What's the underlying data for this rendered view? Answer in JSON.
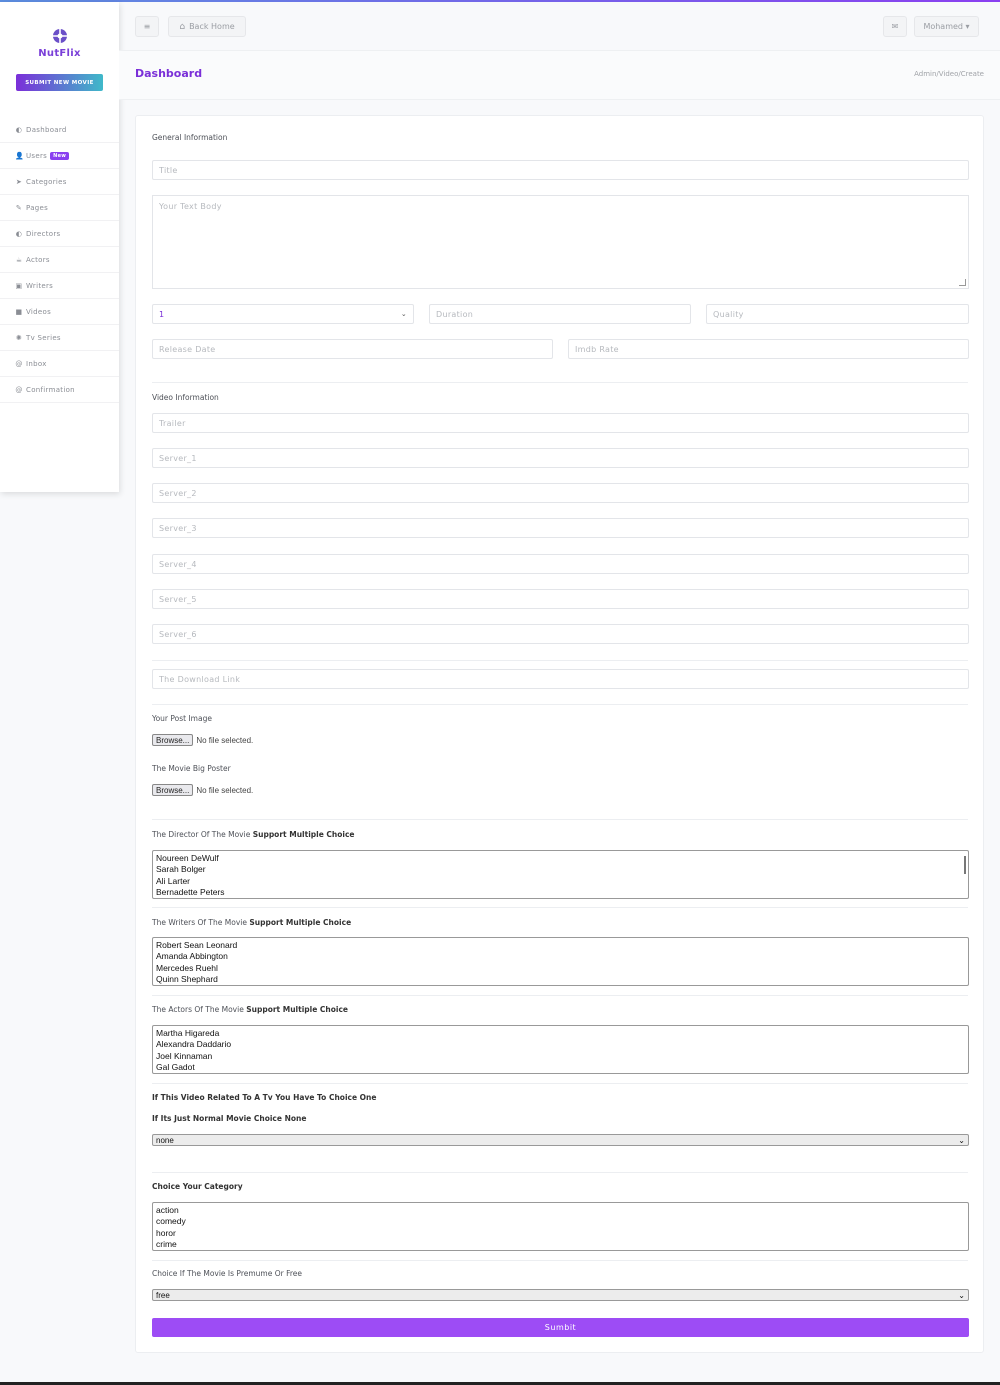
{
  "app": {
    "brand": "NutFlix",
    "submit_new_movie": "SUBMIT NEW MOVIE"
  },
  "sidebar": {
    "items": [
      {
        "icon": "◐",
        "label": "Dashboard"
      },
      {
        "icon": "👤",
        "label": "Users",
        "badge": "New"
      },
      {
        "icon": "➤",
        "label": "Categories"
      },
      {
        "icon": "✎",
        "label": "Pages"
      },
      {
        "icon": "◐",
        "label": "Directors"
      },
      {
        "icon": "☕",
        "label": "Actors"
      },
      {
        "icon": "▣",
        "label": "Writers"
      },
      {
        "icon": "■",
        "label": "Videos"
      },
      {
        "icon": "✺",
        "label": "Tv Series"
      },
      {
        "icon": "@",
        "label": "Inbox"
      },
      {
        "icon": "@",
        "label": "Confirmation"
      }
    ]
  },
  "topbar": {
    "menu_icon": "≡",
    "back_home": "Back Home",
    "home_icon": "⌂",
    "mail_icon": "✉",
    "user": "Mohamed ▾"
  },
  "header": {
    "title": "Dashboard",
    "breadcrumb": "Admin/Video/Create"
  },
  "form": {
    "general_heading": "General Information",
    "title_placeholder": "Title",
    "body_placeholder": "Your Text Body",
    "select_value": "1",
    "duration_placeholder": "Duration",
    "quality_placeholder": "Quality",
    "release_placeholder": "Release Date",
    "imdb_placeholder": "Imdb Rate",
    "video_heading": "Video Information",
    "trailer_placeholder": "Trailer",
    "servers": [
      "Server_1",
      "Server_2",
      "Server_3",
      "Server_4",
      "Server_5",
      "Server_6"
    ],
    "download_placeholder": "The Download Link",
    "post_image_label": "Your Post Image",
    "big_poster_label": "The Movie Big Poster",
    "browse_label": "Browse...",
    "no_file": "No file selected.",
    "director_label": "The Director Of The Movie",
    "multiple_hint": "Support Multiple Choice",
    "directors": [
      "Noureen DeWulf",
      "Sarah Bolger",
      "Ali Larter",
      "Bernadette Peters"
    ],
    "writers_label": "The Writers Of The Movie",
    "writers": [
      "Robert Sean Leonard",
      "Amanda Abbington",
      "Mercedes Ruehl",
      "Quinn Shephard"
    ],
    "actors_label": "The Actors Of The Movie",
    "actors": [
      "Martha Higareda",
      "Alexandra Daddario",
      "Joel Kinnaman",
      "Gal Gadot"
    ],
    "tv_note_1": "If This Video Related To A Tv You Have To Choice One",
    "tv_note_2": "If Its Just Normal Movie Choice None",
    "tv_value": "none",
    "category_label": "Choice Your Category",
    "categories": [
      "action",
      "comedy",
      "horor",
      "crime"
    ],
    "premium_label": "Choice If The Movie Is Premume Or Free",
    "premium_value": "free",
    "submit_label": "Sumbit"
  },
  "colors": {
    "accent": "#7a2fd8",
    "button": "#9d4cf5"
  }
}
